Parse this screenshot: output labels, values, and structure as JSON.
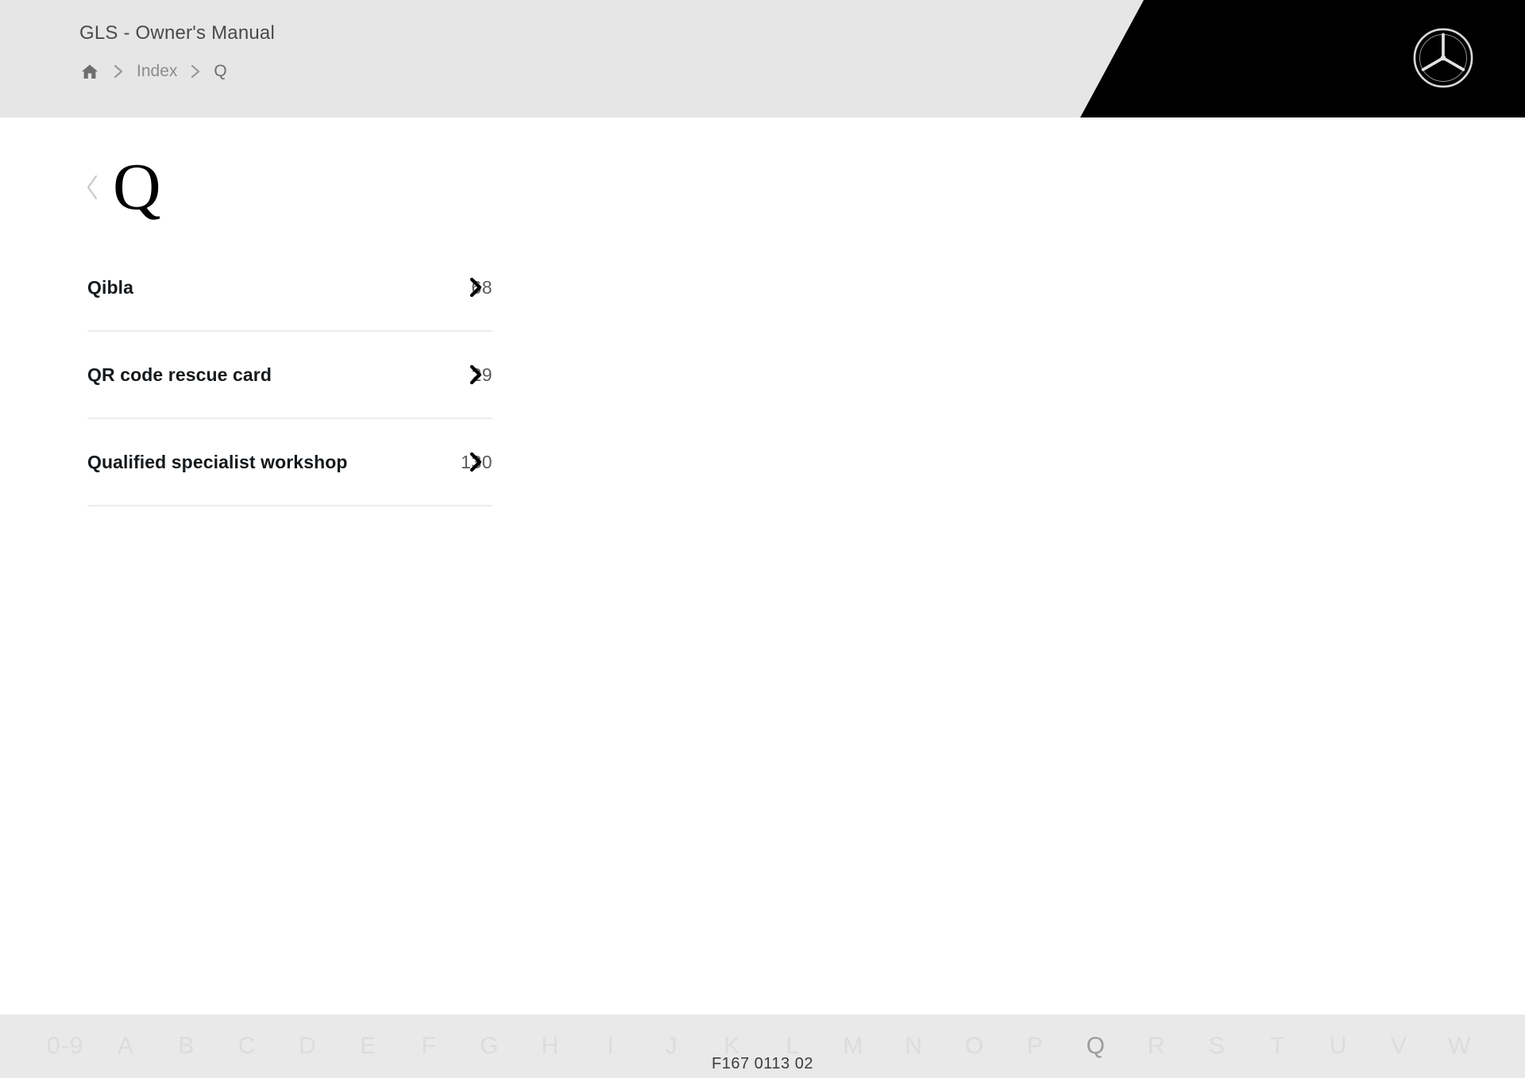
{
  "header": {
    "manual_title": "GLS - Owner's Manual",
    "breadcrumb": {
      "home_icon": "home-icon",
      "separator": "›",
      "index_label": "Index",
      "current_label": "Q"
    },
    "brand_logo": "mercedes-benz-star-icon",
    "black_panel_color": "#000000",
    "background_color": "#e6e6e6"
  },
  "main": {
    "back_icon": "chevron-left-icon",
    "letter_title": "Q",
    "entries": [
      {
        "label": "Qibla",
        "page": "68",
        "chevron": "chevron-right-icon"
      },
      {
        "label": "QR code rescue card",
        "page": "29",
        "chevron": "chevron-right-icon"
      },
      {
        "label": "Qualified specialist workshop",
        "page": "130",
        "chevron": "chevron-right-icon"
      }
    ]
  },
  "footer": {
    "alphabet": [
      {
        "label": "0-9",
        "active": false
      },
      {
        "label": "A",
        "active": false
      },
      {
        "label": "B",
        "active": false
      },
      {
        "label": "C",
        "active": false
      },
      {
        "label": "D",
        "active": false
      },
      {
        "label": "E",
        "active": false
      },
      {
        "label": "F",
        "active": false
      },
      {
        "label": "G",
        "active": false
      },
      {
        "label": "H",
        "active": false
      },
      {
        "label": "I",
        "active": false
      },
      {
        "label": "J",
        "active": false
      },
      {
        "label": "K",
        "active": false
      },
      {
        "label": "L",
        "active": false
      },
      {
        "label": "M",
        "active": false
      },
      {
        "label": "N",
        "active": false
      },
      {
        "label": "O",
        "active": false
      },
      {
        "label": "P",
        "active": false
      },
      {
        "label": "Q",
        "active": true
      },
      {
        "label": "R",
        "active": false
      },
      {
        "label": "S",
        "active": false
      },
      {
        "label": "T",
        "active": false
      },
      {
        "label": "U",
        "active": false
      },
      {
        "label": "V",
        "active": false
      },
      {
        "label": "W",
        "active": false
      }
    ],
    "document_code": "F167 0113 02",
    "background_color": "#e9e9e9"
  }
}
